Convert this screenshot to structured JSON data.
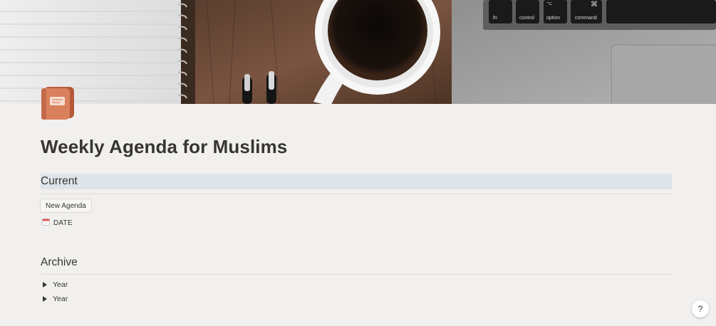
{
  "cover": {
    "keyboard_keys": [
      "fn",
      "control",
      "option",
      "command"
    ],
    "keyboard_symbols": [
      "⌥",
      "⌘"
    ]
  },
  "page": {
    "icon": "book-icon",
    "title": "Weekly Agenda for Muslims"
  },
  "current": {
    "heading": "Current",
    "new_button_label": "New Agenda",
    "link_icon": "calendar-icon",
    "link_label": "DATE"
  },
  "archive": {
    "heading": "Archive",
    "toggles": [
      {
        "label": "Year"
      },
      {
        "label": "Year"
      }
    ]
  },
  "help": {
    "label": "?"
  },
  "colors": {
    "background": "#f1f0ef",
    "text": "#37352f",
    "current_heading_bg": "#dde5ea",
    "icon_orange": "#d9805c"
  }
}
